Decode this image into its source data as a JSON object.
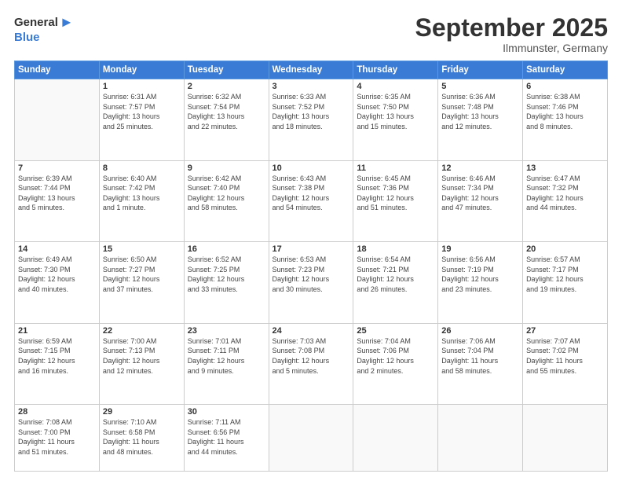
{
  "header": {
    "logo_general": "General",
    "logo_blue": "Blue",
    "month": "September 2025",
    "location": "Ilmmunster, Germany"
  },
  "weekdays": [
    "Sunday",
    "Monday",
    "Tuesday",
    "Wednesday",
    "Thursday",
    "Friday",
    "Saturday"
  ],
  "weeks": [
    [
      {
        "day": "",
        "info": ""
      },
      {
        "day": "1",
        "info": "Sunrise: 6:31 AM\nSunset: 7:57 PM\nDaylight: 13 hours\nand 25 minutes."
      },
      {
        "day": "2",
        "info": "Sunrise: 6:32 AM\nSunset: 7:54 PM\nDaylight: 13 hours\nand 22 minutes."
      },
      {
        "day": "3",
        "info": "Sunrise: 6:33 AM\nSunset: 7:52 PM\nDaylight: 13 hours\nand 18 minutes."
      },
      {
        "day": "4",
        "info": "Sunrise: 6:35 AM\nSunset: 7:50 PM\nDaylight: 13 hours\nand 15 minutes."
      },
      {
        "day": "5",
        "info": "Sunrise: 6:36 AM\nSunset: 7:48 PM\nDaylight: 13 hours\nand 12 minutes."
      },
      {
        "day": "6",
        "info": "Sunrise: 6:38 AM\nSunset: 7:46 PM\nDaylight: 13 hours\nand 8 minutes."
      }
    ],
    [
      {
        "day": "7",
        "info": "Sunrise: 6:39 AM\nSunset: 7:44 PM\nDaylight: 13 hours\nand 5 minutes."
      },
      {
        "day": "8",
        "info": "Sunrise: 6:40 AM\nSunset: 7:42 PM\nDaylight: 13 hours\nand 1 minute."
      },
      {
        "day": "9",
        "info": "Sunrise: 6:42 AM\nSunset: 7:40 PM\nDaylight: 12 hours\nand 58 minutes."
      },
      {
        "day": "10",
        "info": "Sunrise: 6:43 AM\nSunset: 7:38 PM\nDaylight: 12 hours\nand 54 minutes."
      },
      {
        "day": "11",
        "info": "Sunrise: 6:45 AM\nSunset: 7:36 PM\nDaylight: 12 hours\nand 51 minutes."
      },
      {
        "day": "12",
        "info": "Sunrise: 6:46 AM\nSunset: 7:34 PM\nDaylight: 12 hours\nand 47 minutes."
      },
      {
        "day": "13",
        "info": "Sunrise: 6:47 AM\nSunset: 7:32 PM\nDaylight: 12 hours\nand 44 minutes."
      }
    ],
    [
      {
        "day": "14",
        "info": "Sunrise: 6:49 AM\nSunset: 7:30 PM\nDaylight: 12 hours\nand 40 minutes."
      },
      {
        "day": "15",
        "info": "Sunrise: 6:50 AM\nSunset: 7:27 PM\nDaylight: 12 hours\nand 37 minutes."
      },
      {
        "day": "16",
        "info": "Sunrise: 6:52 AM\nSunset: 7:25 PM\nDaylight: 12 hours\nand 33 minutes."
      },
      {
        "day": "17",
        "info": "Sunrise: 6:53 AM\nSunset: 7:23 PM\nDaylight: 12 hours\nand 30 minutes."
      },
      {
        "day": "18",
        "info": "Sunrise: 6:54 AM\nSunset: 7:21 PM\nDaylight: 12 hours\nand 26 minutes."
      },
      {
        "day": "19",
        "info": "Sunrise: 6:56 AM\nSunset: 7:19 PM\nDaylight: 12 hours\nand 23 minutes."
      },
      {
        "day": "20",
        "info": "Sunrise: 6:57 AM\nSunset: 7:17 PM\nDaylight: 12 hours\nand 19 minutes."
      }
    ],
    [
      {
        "day": "21",
        "info": "Sunrise: 6:59 AM\nSunset: 7:15 PM\nDaylight: 12 hours\nand 16 minutes."
      },
      {
        "day": "22",
        "info": "Sunrise: 7:00 AM\nSunset: 7:13 PM\nDaylight: 12 hours\nand 12 minutes."
      },
      {
        "day": "23",
        "info": "Sunrise: 7:01 AM\nSunset: 7:11 PM\nDaylight: 12 hours\nand 9 minutes."
      },
      {
        "day": "24",
        "info": "Sunrise: 7:03 AM\nSunset: 7:08 PM\nDaylight: 12 hours\nand 5 minutes."
      },
      {
        "day": "25",
        "info": "Sunrise: 7:04 AM\nSunset: 7:06 PM\nDaylight: 12 hours\nand 2 minutes."
      },
      {
        "day": "26",
        "info": "Sunrise: 7:06 AM\nSunset: 7:04 PM\nDaylight: 11 hours\nand 58 minutes."
      },
      {
        "day": "27",
        "info": "Sunrise: 7:07 AM\nSunset: 7:02 PM\nDaylight: 11 hours\nand 55 minutes."
      }
    ],
    [
      {
        "day": "28",
        "info": "Sunrise: 7:08 AM\nSunset: 7:00 PM\nDaylight: 11 hours\nand 51 minutes."
      },
      {
        "day": "29",
        "info": "Sunrise: 7:10 AM\nSunset: 6:58 PM\nDaylight: 11 hours\nand 48 minutes."
      },
      {
        "day": "30",
        "info": "Sunrise: 7:11 AM\nSunset: 6:56 PM\nDaylight: 11 hours\nand 44 minutes."
      },
      {
        "day": "",
        "info": ""
      },
      {
        "day": "",
        "info": ""
      },
      {
        "day": "",
        "info": ""
      },
      {
        "day": "",
        "info": ""
      }
    ]
  ]
}
